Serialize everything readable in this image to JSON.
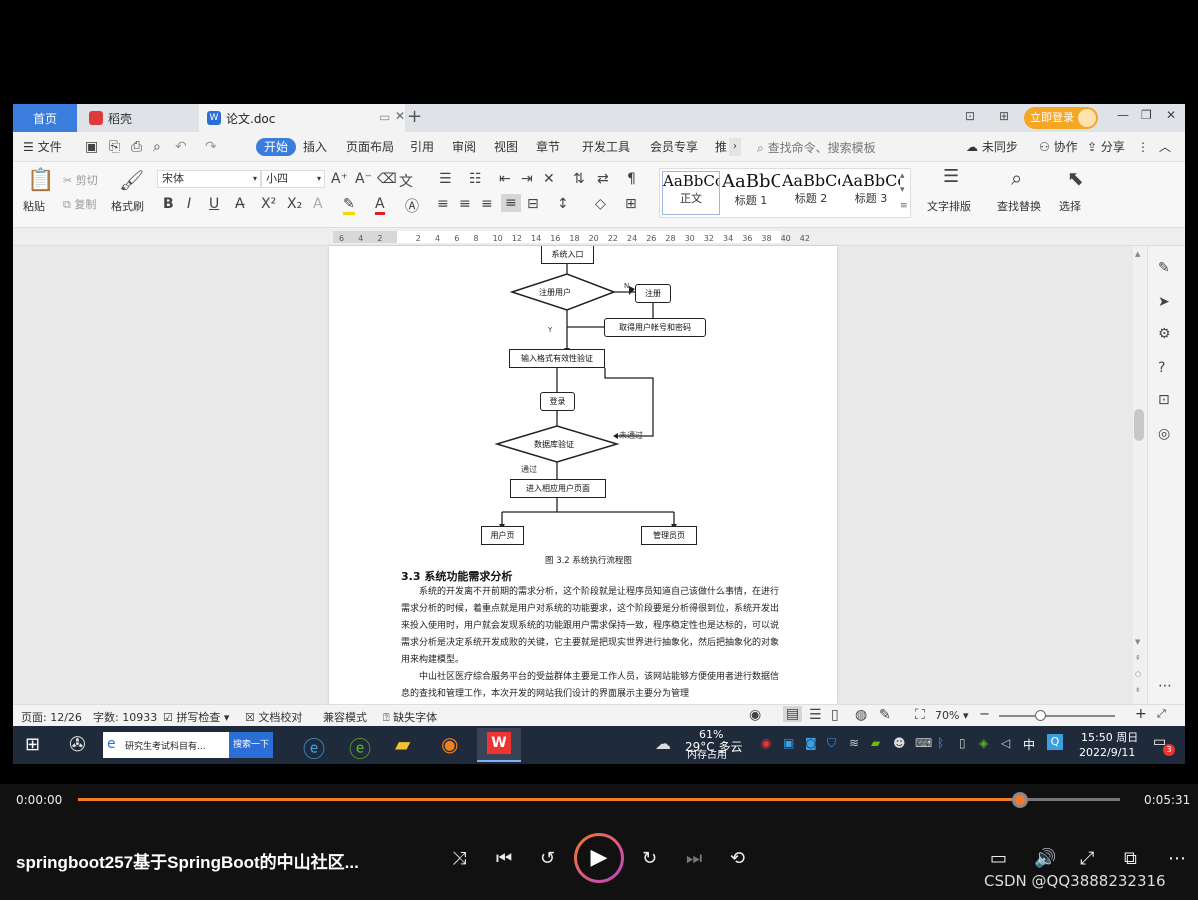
{
  "wps": {
    "tabs": {
      "home": "首页",
      "daoke": "稻壳",
      "doc": "论文.doc",
      "login": "立即登录"
    },
    "menu": {
      "file": "文件",
      "items": [
        "开始",
        "插入",
        "页面布局",
        "引用",
        "审阅",
        "视图",
        "章节",
        "开发工具",
        "会员专享",
        "推"
      ],
      "search_placeholder": "查找命令、搜索模板",
      "unsync": "未同步",
      "collab": "协作",
      "share": "分享"
    },
    "ribbon": {
      "paste": "粘贴",
      "cut": "剪切",
      "copy": "复制",
      "format_painter": "格式刷",
      "font_name": "宋体",
      "font_size": "小四",
      "styles": [
        {
          "sample": "AaBbCcI",
          "name": "正文"
        },
        {
          "sample": "AaBbC",
          "name": "标题 1"
        },
        {
          "sample": "AaBbCc",
          "name": "标题 2"
        },
        {
          "sample": "AaBbCc",
          "name": "标题 3"
        }
      ],
      "text_layout": "文字排版",
      "find_replace": "查找替换",
      "select": "选择"
    },
    "ruler": [
      "6",
      "4",
      "2",
      "",
      "2",
      "4",
      "6",
      "8",
      "10",
      "12",
      "14",
      "16",
      "18",
      "20",
      "22",
      "24",
      "26",
      "28",
      "30",
      "32",
      "34",
      "36",
      "38",
      "40",
      "42"
    ],
    "document": {
      "flow": {
        "entry": "系统入口",
        "register_user": "注册用户",
        "n_label": "N",
        "register": "注册",
        "get_account": "取得用户帐号和密码",
        "y_label": "Y",
        "validate_input": "输入格式有效性验证",
        "login": "登录",
        "db_verify": "数据库验证",
        "fail_label": "未通过",
        "pass_label": "通过",
        "enter_page": "进入相应用户页面",
        "user_page": "用户页",
        "admin_page": "管理员页"
      },
      "caption": "图 3.2  系统执行流程图",
      "section_title": "3.3 系统功能需求分析",
      "paragraphs": [
        "系统的开发离不开前期的需求分析，这个阶段就是让程序员知道自己该做什么事情，在进行需求分析的时候，着重点就是用户对系统的功能要求，这个阶段要是分析得很到位，系统开发出来投入使用时，用户就会发现系统的功能跟用户需求保持一致，程序稳定性也是达标的，可以说需求分析是决定系统开发成败的关键，它主要就是把现实世界进行抽象化，然后把抽象化的对象用来构建模型。",
        "中山社区医疗综合服务平台的受益群体主要是工作人员，该网站能够方便使用者进行数据信息的查找和管理工作，本次开发的网站我们设计的界面展示主要分为管理"
      ]
    },
    "status": {
      "page": "页面: 12/26",
      "words": "字数: 10933",
      "spell": "拼写检查",
      "proof": "文档校对",
      "compat": "兼容模式",
      "missing_font": "缺失字体",
      "zoom": "70%"
    },
    "taskbar": {
      "browser_tab": "研究生考试科目有...",
      "search_button": "搜索一下",
      "weather": "29°C 多云",
      "memory_percent": "61%",
      "memory_label": "内存占用",
      "ime": "中",
      "time": "15:50 周日",
      "date": "2022/9/11",
      "notif_count": "3"
    }
  },
  "player": {
    "current_time": "0:00:00",
    "total_time": "0:05:31",
    "progress": 0.904,
    "title": "springboot257基于SpringBoot的中山社区...",
    "watermark": "CSDN @QQ3888232316",
    "accent": "#f37a2b"
  }
}
